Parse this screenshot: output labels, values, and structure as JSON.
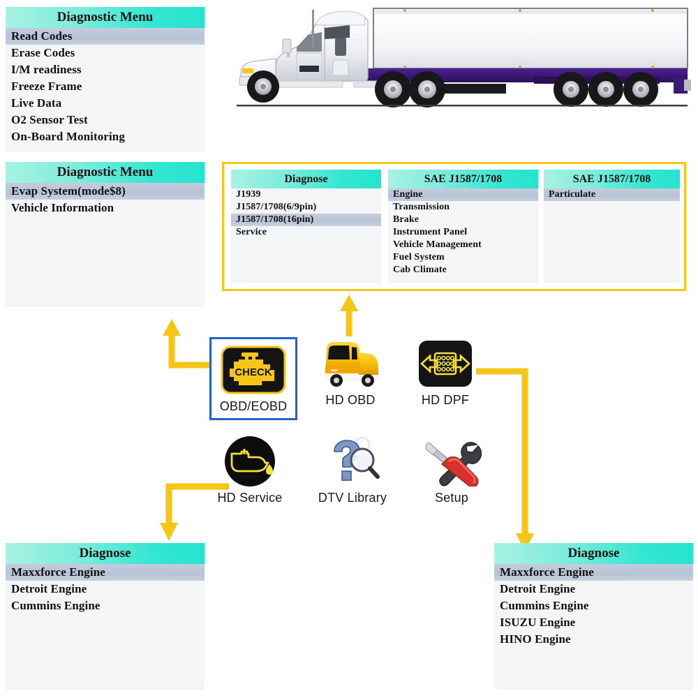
{
  "colors": {
    "header_gradient_start": "#a8f2e2",
    "header_gradient_end": "#25e3cf",
    "selected_row": "#b7c3d6",
    "panel_bg": "#f4f5f7",
    "arrow_yellow": "#f5c518",
    "highlight_border_blue": "#1f63c8",
    "flow_box_border": "#f5c518",
    "icon_yellow": "#f5c518",
    "icon_black": "#111111",
    "truck_body": "#efeff2",
    "trailer_chassis": "#3b1a78",
    "setup_red": "#d8312c"
  },
  "panels": {
    "diagnostic_menu_1": {
      "title": "Diagnostic Menu",
      "items": [
        {
          "label": "Read Codes",
          "selected": true
        },
        {
          "label": "Erase Codes",
          "selected": false
        },
        {
          "label": "I/M readiness",
          "selected": false
        },
        {
          "label": "Freeze Frame",
          "selected": false
        },
        {
          "label": "Live Data",
          "selected": false
        },
        {
          "label": "O2 Sensor Test",
          "selected": false
        },
        {
          "label": "On-Board Monitoring",
          "selected": false
        }
      ]
    },
    "diagnostic_menu_2": {
      "title": "Diagnostic Menu",
      "items": [
        {
          "label": "Evap System(mode$8)",
          "selected": true
        },
        {
          "label": "Vehicle Information",
          "selected": false
        }
      ]
    },
    "diagnose_protocol": {
      "title": "Diagnose",
      "items": [
        {
          "label": "J1939",
          "selected": false
        },
        {
          "label": "J1587/1708(6/9pin)",
          "selected": false
        },
        {
          "label": "J1587/1708(16pin)",
          "selected": true
        },
        {
          "label": "Service",
          "selected": false
        }
      ]
    },
    "sae_systems": {
      "title": "SAE J1587/1708",
      "items": [
        {
          "label": "Engine",
          "selected": true
        },
        {
          "label": "Transmission",
          "selected": false
        },
        {
          "label": "Brake",
          "selected": false
        },
        {
          "label": "Instrument Panel",
          "selected": false
        },
        {
          "label": "Vehicle Management",
          "selected": false
        },
        {
          "label": "Fuel System",
          "selected": false
        },
        {
          "label": "Cab Climate",
          "selected": false
        }
      ]
    },
    "sae_particulate": {
      "title": "SAE J1587/1708",
      "items": [
        {
          "label": "Particulate",
          "selected": true
        }
      ]
    },
    "diagnose_engines_left": {
      "title": "Diagnose",
      "items": [
        {
          "label": "Maxxforce Engine",
          "selected": true
        },
        {
          "label": "Detroit Engine",
          "selected": false
        },
        {
          "label": "Cummins Engine",
          "selected": false
        }
      ]
    },
    "diagnose_engines_right": {
      "title": "Diagnose",
      "items": [
        {
          "label": "Maxxforce Engine",
          "selected": true
        },
        {
          "label": "Detroit Engine",
          "selected": false
        },
        {
          "label": "Cummins Engine",
          "selected": false
        },
        {
          "label": "ISUZU Engine",
          "selected": false
        },
        {
          "label": "HINO Engine",
          "selected": false
        }
      ]
    }
  },
  "icons": {
    "obd_eobd": {
      "label": "OBD/EOBD",
      "icon": "check-engine-icon",
      "badge_text": "CHECK",
      "highlighted": true
    },
    "hd_obd": {
      "label": "HD OBD",
      "icon": "truck-icon",
      "highlighted": false
    },
    "hd_dpf": {
      "label": "HD DPF",
      "icon": "dpf-filter-icon",
      "highlighted": false
    },
    "hd_service": {
      "label": "HD Service",
      "icon": "oil-can-icon",
      "highlighted": false
    },
    "dtv_library": {
      "label": "DTV Library",
      "icon": "question-magnifier-icon",
      "highlighted": false
    },
    "setup": {
      "label": "Setup",
      "icon": "wrench-screwdriver-icon",
      "highlighted": false
    }
  },
  "illustration": {
    "name": "semi-truck-trailer-illustration"
  }
}
